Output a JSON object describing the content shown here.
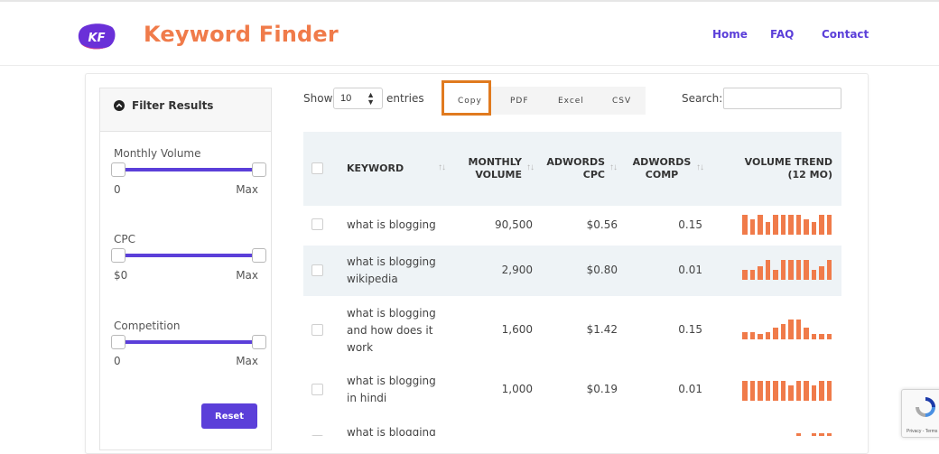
{
  "header": {
    "logo_text": "KF",
    "brand": "Keyword Finder",
    "nav": [
      "Home",
      "FAQ",
      "Contact"
    ],
    "accent_color": "#5b3fd9",
    "brand_color": "#f07b4a"
  },
  "filters": {
    "title": "Filter Results",
    "groups": [
      {
        "label": "Monthly Volume",
        "min": "0",
        "max": "Max"
      },
      {
        "label": "CPC",
        "min": "$0",
        "max": "Max"
      },
      {
        "label": "Competition",
        "min": "0",
        "max": "Max"
      }
    ],
    "reset_label": "Reset"
  },
  "table_controls": {
    "show_label": "Show",
    "entries_value": "10",
    "entries_label": "entries",
    "buttons": [
      "Copy",
      "PDF",
      "Excel",
      "CSV"
    ],
    "search_label": "Search:",
    "search_value": ""
  },
  "table": {
    "columns": [
      "KEYWORD",
      "MONTHLY VOLUME",
      "ADWORDS CPC",
      "ADWORDS COMP",
      "VOLUME TREND (12 MO)"
    ],
    "rows": [
      {
        "keyword": "what is blogging",
        "volume": "90,500",
        "cpc": "$0.56",
        "comp": "0.15",
        "trend": [
          22,
          17,
          22,
          14,
          22,
          22,
          22,
          22,
          17,
          14,
          22,
          22
        ]
      },
      {
        "keyword": "what is blogging wikipedia",
        "volume": "2,900",
        "cpc": "$0.80",
        "comp": "0.01",
        "trend": [
          11,
          11,
          15,
          22,
          11,
          22,
          22,
          22,
          22,
          11,
          15,
          22
        ]
      },
      {
        "keyword": "what is blogging and how does it work",
        "volume": "1,600",
        "cpc": "$1.42",
        "comp": "0.15",
        "trend": [
          8,
          8,
          6,
          8,
          13,
          17,
          22,
          22,
          13,
          6,
          6,
          6
        ]
      },
      {
        "keyword": "what is blogging in hindi",
        "volume": "1,000",
        "cpc": "$0.19",
        "comp": "0.01",
        "trend": [
          22,
          22,
          22,
          22,
          22,
          22,
          17,
          22,
          22,
          17,
          22,
          22
        ]
      },
      {
        "keyword": "what is blogging",
        "volume": "",
        "cpc": "",
        "comp": "",
        "trend": [
          0,
          0,
          0,
          0,
          0,
          0,
          0,
          4,
          0,
          4,
          4,
          4
        ]
      }
    ]
  },
  "recaptcha": {
    "text": "Privacy - Terms"
  }
}
